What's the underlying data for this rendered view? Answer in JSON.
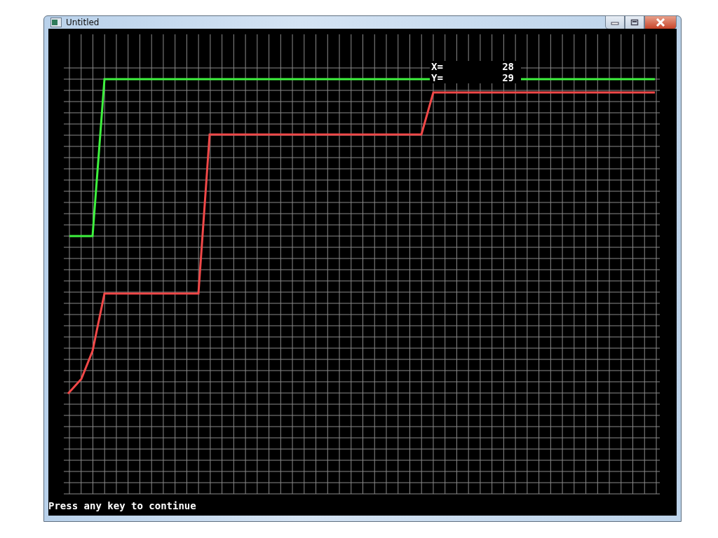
{
  "window": {
    "title": "Untitled"
  },
  "readout": [
    {
      "label": "X=",
      "value": "28"
    },
    {
      "label": "Y=",
      "value": "29"
    }
  ],
  "console": {
    "prompt": "Press any key to continue"
  }
}
